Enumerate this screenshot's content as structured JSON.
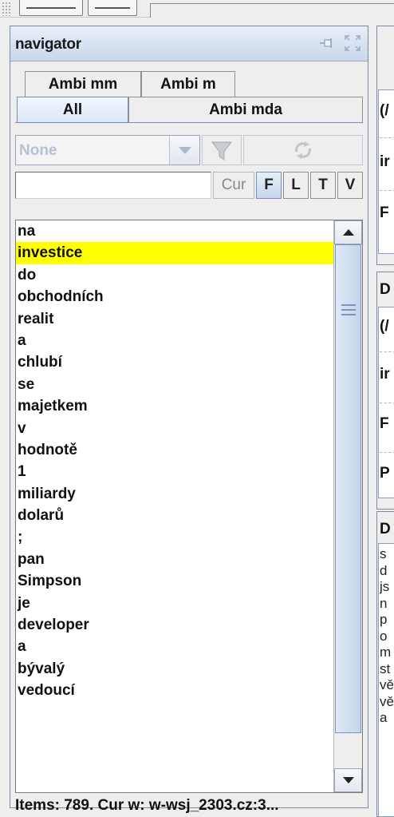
{
  "navigator": {
    "title": "navigator",
    "tabs_row1": [
      "Ambi mm",
      "Ambi m"
    ],
    "tabs_row2": [
      "All",
      "Ambi mda"
    ],
    "selected_tab": "All",
    "combo_value": "None",
    "search_value": "",
    "cur_label": "Cur",
    "toggles": [
      "F",
      "L",
      "T",
      "V"
    ],
    "toggle_on": "F",
    "selected_word": "investice",
    "words": [
      "na",
      "investice",
      "do",
      "obchodních",
      "realit",
      "a",
      "chlubí",
      "se",
      "majetkem",
      "v",
      "hodnotě",
      "1",
      "miliardy",
      "dolarů",
      ";",
      "pan",
      "Simpson",
      "je",
      "developer",
      "a",
      "bývalý",
      "vedoucí"
    ],
    "status": "Items: 789. Cur w: w-wsj_2303.cz:3..."
  },
  "right_panel": {
    "labels_top": [
      "(/",
      "ir",
      "F"
    ],
    "labels_mid": [
      "D",
      "(/",
      "ir",
      "F",
      "P"
    ],
    "label_bottom": "D",
    "text_lines": [
      "s",
      "d",
      "js",
      "n",
      "p",
      "o",
      "m",
      "st",
      "vě",
      "vě",
      "a"
    ]
  },
  "colors": {
    "selection": "#ffff00",
    "header_gradient": "#c9d8ec",
    "border_accent": "#7a8aa4"
  },
  "icons": {
    "pin": "pin-icon",
    "maximize": "maximize-icon",
    "filter": "filter-icon",
    "refresh": "refresh-icon"
  }
}
